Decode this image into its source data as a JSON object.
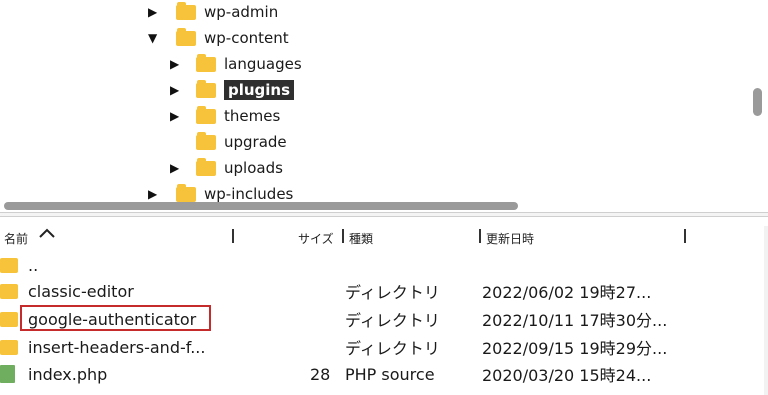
{
  "tree": {
    "items": [
      {
        "label": "wp-admin",
        "expander": "▶"
      },
      {
        "label": "wp-content",
        "expander": "▼"
      },
      {
        "label": "languages",
        "expander": "▶"
      },
      {
        "label": "plugins",
        "expander": "▶",
        "selected": true
      },
      {
        "label": "themes",
        "expander": "▶"
      },
      {
        "label": "upgrade",
        "expander": ""
      },
      {
        "label": "uploads",
        "expander": "▶"
      },
      {
        "label": "wp-includes",
        "expander": "▶"
      }
    ]
  },
  "columns": {
    "name": "名前",
    "sort_icon": "chevron-up-icon",
    "size": "サイズ",
    "type": "種類",
    "modified": "更新日時"
  },
  "files": [
    {
      "name": "..",
      "size": "",
      "type": "",
      "date": "",
      "icon": "folder-icon"
    },
    {
      "name": "classic-editor",
      "size": "",
      "type": "ディレクトリ",
      "date": "2022/06/02 19時27...",
      "icon": "folder-icon"
    },
    {
      "name": "google-authenticator",
      "size": "",
      "type": "ディレクトリ",
      "date": "2022/10/11 17時30分...",
      "icon": "folder-icon",
      "highlighted": true
    },
    {
      "name": "insert-headers-and-f...",
      "size": "",
      "type": "ディレクトリ",
      "date": "2022/09/15 19時29分...",
      "icon": "folder-icon"
    },
    {
      "name": "index.php",
      "size": "28",
      "type": "PHP source",
      "date": "2020/03/20 15時24...",
      "icon": "php-file-icon"
    }
  ],
  "colors": {
    "folder": "#f7c33a",
    "highlight_border": "#c62b2b",
    "selection": "#2f2f2f"
  }
}
